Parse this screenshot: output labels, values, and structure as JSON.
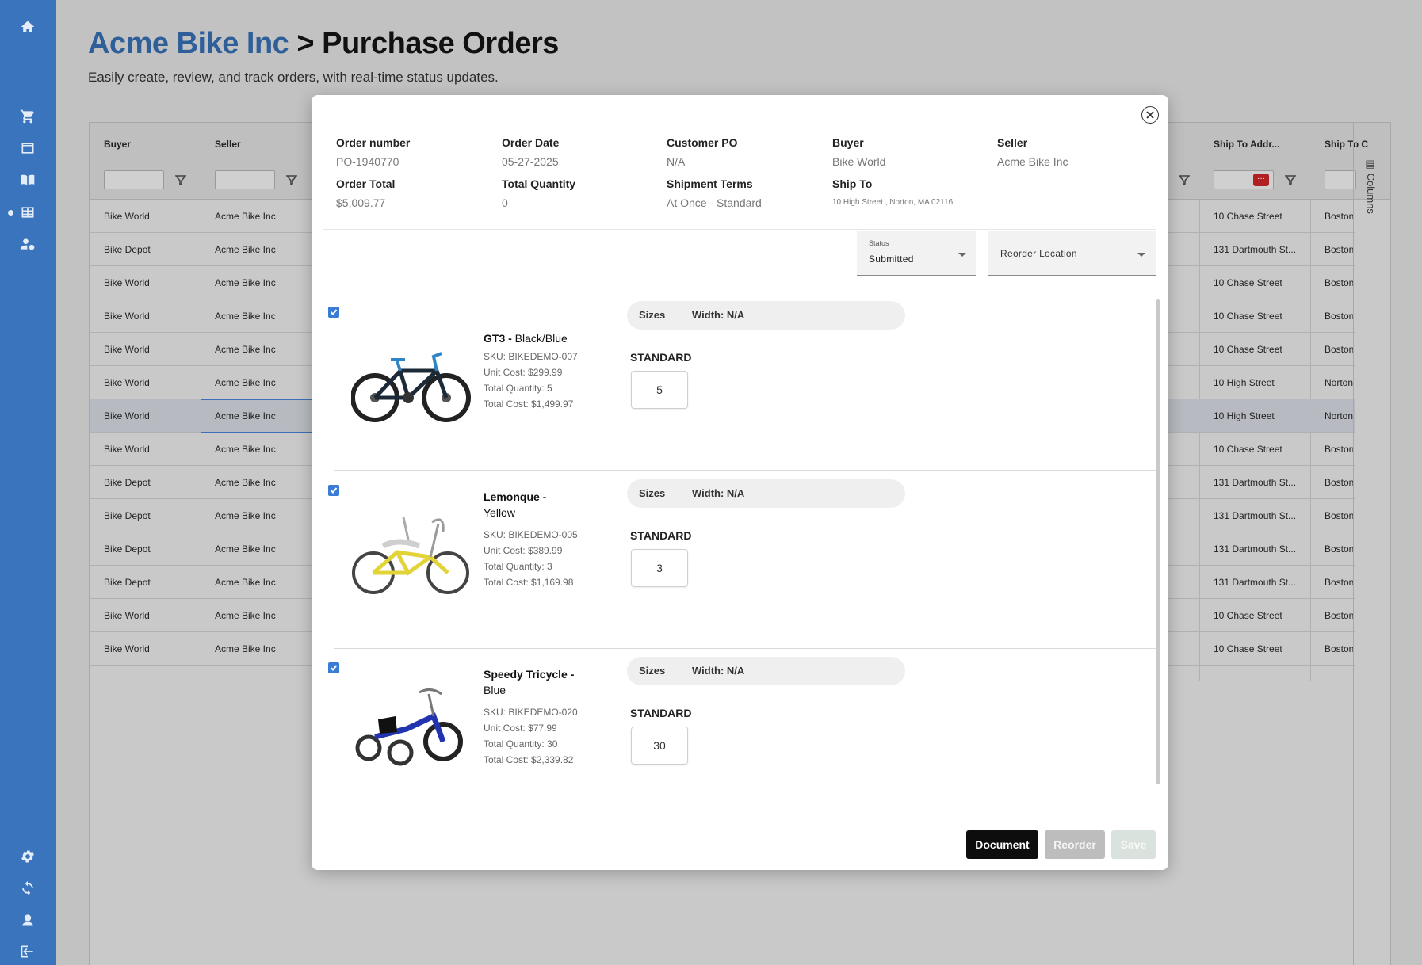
{
  "header": {
    "brand": "Acme Bike Inc",
    "separator": ">",
    "title": "Purchase Orders",
    "subtitle": "Easily create, review, and track orders, with real-time status updates."
  },
  "sidebar": {
    "icons": [
      "home-icon",
      "cart-icon",
      "browser-icon",
      "book-icon",
      "table-icon",
      "user-settings-icon",
      "gear-icon",
      "refresh-icon",
      "support-icon",
      "logout-icon"
    ]
  },
  "grid": {
    "columns": [
      "Buyer",
      "Seller",
      "Ship To Addr...",
      "Ship To C"
    ],
    "columns_tab": "Columns",
    "filter_chip": "···",
    "rows": [
      {
        "buyer": "Bike World",
        "seller": "Acme Bike Inc",
        "address": "10 Chase Street",
        "city": "Boston"
      },
      {
        "buyer": "Bike Depot",
        "seller": "Acme Bike Inc",
        "address": "131 Dartmouth St...",
        "city": "Boston"
      },
      {
        "buyer": "Bike World",
        "seller": "Acme Bike Inc",
        "address": "10 Chase Street",
        "city": "Boston"
      },
      {
        "buyer": "Bike World",
        "seller": "Acme Bike Inc",
        "address": "10 Chase Street",
        "city": "Boston"
      },
      {
        "buyer": "Bike World",
        "seller": "Acme Bike Inc",
        "address": "10 Chase Street",
        "city": "Boston"
      },
      {
        "buyer": "Bike World",
        "seller": "Acme Bike Inc",
        "address": "10 High Street",
        "city": "Norton"
      },
      {
        "buyer": "Bike World",
        "seller": "Acme Bike Inc",
        "address": "10 High Street",
        "city": "Norton"
      },
      {
        "buyer": "Bike World",
        "seller": "Acme Bike Inc",
        "address": "10 Chase Street",
        "city": "Boston"
      },
      {
        "buyer": "Bike Depot",
        "seller": "Acme Bike Inc",
        "address": "131 Dartmouth St...",
        "city": "Boston"
      },
      {
        "buyer": "Bike Depot",
        "seller": "Acme Bike Inc",
        "address": "131 Dartmouth St...",
        "city": "Boston"
      },
      {
        "buyer": "Bike Depot",
        "seller": "Acme Bike Inc",
        "address": "131 Dartmouth St...",
        "city": "Boston"
      },
      {
        "buyer": "Bike Depot",
        "seller": "Acme Bike Inc",
        "address": "131 Dartmouth St...",
        "city": "Boston"
      },
      {
        "buyer": "Bike World",
        "seller": "Acme Bike Inc",
        "address": "10 Chase Street",
        "city": "Boston"
      },
      {
        "buyer": "Bike World",
        "seller": "Acme Bike Inc",
        "address": "10 Chase Street",
        "city": "Boston"
      }
    ]
  },
  "modal": {
    "order_number_label": "Order number",
    "order_number": "PO-1940770",
    "order_date_label": "Order Date",
    "order_date": "05-27-2025",
    "customer_po_label": "Customer PO",
    "customer_po": "N/A",
    "buyer_label": "Buyer",
    "buyer": "Bike World",
    "seller_label": "Seller",
    "seller": "Acme Bike Inc",
    "order_total_label": "Order Total",
    "order_total": "$5,009.77",
    "total_quantity_label": "Total Quantity",
    "total_quantity": "0",
    "shipment_terms_label": "Shipment Terms",
    "shipment_terms": "At Once - Standard",
    "ship_to_label": "Ship To",
    "ship_to": "10 High Street , Norton, MA 02116",
    "status_caption": "Status",
    "status_value": "Submitted",
    "reorder_location": "Reorder Location",
    "items": [
      {
        "name_bold": "GT3 -",
        "name_rest": "Black/Blue",
        "sku": "SKU: BIKEDEMO-007",
        "unit_cost": "Unit Cost: $299.99",
        "total_qty": "Total Quantity: 5",
        "total_cost": "Total Cost: $1,499.97",
        "sizes": "Sizes",
        "width": "Width: N/A",
        "size_label": "STANDARD",
        "qty": "5"
      },
      {
        "name_bold": "Lemonque -",
        "name_rest": "Yellow",
        "sku": "SKU: BIKEDEMO-005",
        "unit_cost": "Unit Cost: $389.99",
        "total_qty": "Total Quantity: 3",
        "total_cost": "Total Cost: $1,169.98",
        "sizes": "Sizes",
        "width": "Width: N/A",
        "size_label": "STANDARD",
        "qty": "3"
      },
      {
        "name_bold": "Speedy Tricycle -",
        "name_rest": "Blue",
        "sku": "SKU: BIKEDEMO-020",
        "unit_cost": "Unit Cost: $77.99",
        "total_qty": "Total Quantity: 30",
        "total_cost": "Total Cost: $2,339.82",
        "sizes": "Sizes",
        "width": "Width: N/A",
        "size_label": "STANDARD",
        "qty": "30"
      }
    ],
    "buttons": {
      "document": "Document",
      "reorder": "Reorder",
      "save": "Save"
    }
  },
  "colors": {
    "sidebar": "#3a74bd",
    "brand": "#2e5f99",
    "checkbox": "#3a7bd5",
    "primary_button": "#0d0d0d"
  }
}
